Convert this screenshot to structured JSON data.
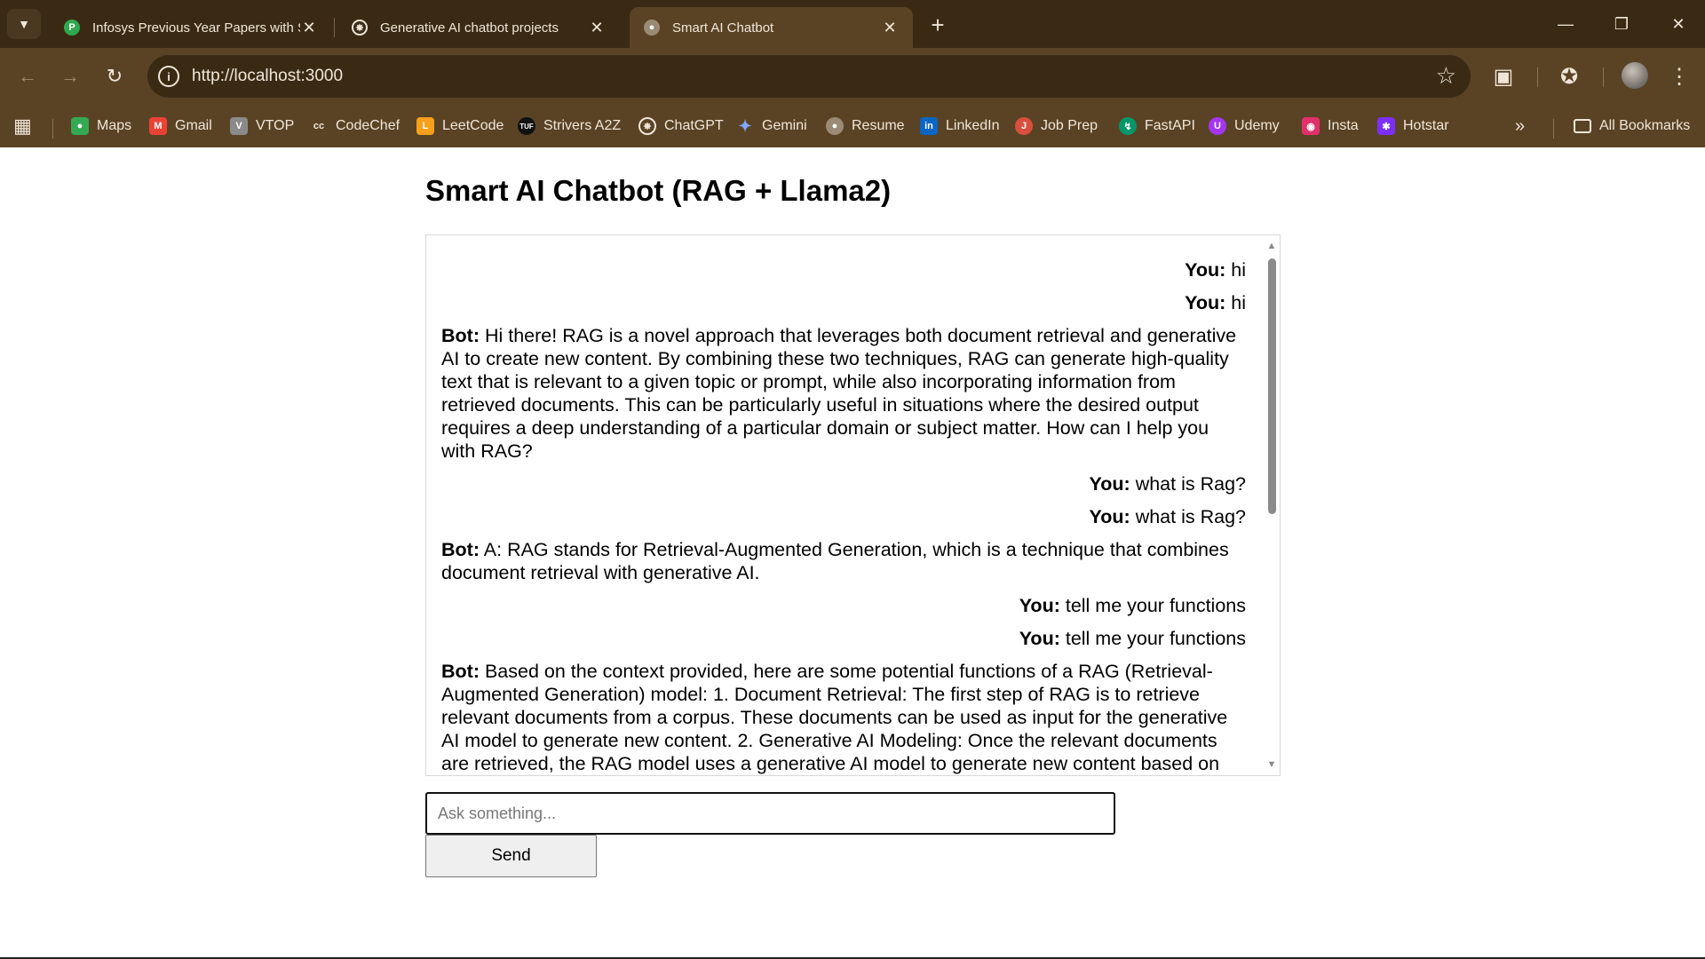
{
  "browser": {
    "tabs": [
      {
        "title": "Infosys Previous Year Papers with S",
        "favicon": "prepinsta-favicon",
        "active": false
      },
      {
        "title": "Generative AI chatbot projects",
        "favicon": "chatgpt-favicon",
        "active": false
      },
      {
        "title": "Smart AI Chatbot",
        "favicon": "globe-favicon",
        "active": true
      }
    ],
    "url": "http://localhost:3000",
    "bookmarks": [
      {
        "label": "Maps",
        "icon": "maps-icon",
        "color": "#34a853"
      },
      {
        "label": "Gmail",
        "icon": "gmail-icon",
        "color": "#ea4335"
      },
      {
        "label": "VTOP",
        "icon": "vtop-icon",
        "color": "#8a8a8a"
      },
      {
        "label": "CodeChef",
        "icon": "codechef-icon",
        "color": "#5b4638"
      },
      {
        "label": "LeetCode",
        "icon": "leetcode-icon",
        "color": "#f89f1b"
      },
      {
        "label": "Strivers A2Z",
        "icon": "tuf-icon",
        "color": "#111111"
      },
      {
        "label": "ChatGPT",
        "icon": "chatgpt-icon",
        "color": "#5a4325"
      },
      {
        "label": "Gemini",
        "icon": "gemini-icon",
        "color": "#4285f4"
      },
      {
        "label": "Resume",
        "icon": "globe-icon",
        "color": "#5a4325"
      },
      {
        "label": "LinkedIn",
        "icon": "linkedin-icon",
        "color": "#0a66c2"
      },
      {
        "label": "Job Prep",
        "icon": "jobprep-icon",
        "color": "#d94f3d"
      },
      {
        "label": "FastAPI",
        "icon": "fastapi-icon",
        "color": "#059669"
      },
      {
        "label": "Udemy",
        "icon": "udemy-icon",
        "color": "#a435f0"
      },
      {
        "label": "Insta",
        "icon": "instagram-icon",
        "color": "#e1306c"
      },
      {
        "label": "Hotstar",
        "icon": "hotstar-icon",
        "color": "#7b2ff7"
      }
    ],
    "all_bookmarks_label": "All Bookmarks"
  },
  "page": {
    "title": "Smart AI Chatbot (RAG + Llama2)",
    "messages": [
      {
        "role": "user",
        "speaker": "You:",
        "text": "hi"
      },
      {
        "role": "user",
        "speaker": "You:",
        "text": "hi"
      },
      {
        "role": "bot",
        "speaker": "Bot:",
        "text": "Hi there! RAG is a novel approach that leverages both document retrieval and generative AI to create new content. By combining these two techniques, RAG can generate high-quality text that is relevant to a given topic or prompt, while also incorporating information from retrieved documents. This can be particularly useful in situations where the desired output requires a deep understanding of a particular domain or subject matter. How can I help you with RAG?"
      },
      {
        "role": "user",
        "speaker": "You:",
        "text": "what is Rag?"
      },
      {
        "role": "user",
        "speaker": "You:",
        "text": "what is Rag?"
      },
      {
        "role": "bot",
        "speaker": "Bot:",
        "text": "A: RAG stands for Retrieval-Augmented Generation, which is a technique that combines document retrieval with generative AI."
      },
      {
        "role": "user",
        "speaker": "You:",
        "text": "tell me your functions"
      },
      {
        "role": "user",
        "speaker": "You:",
        "text": "tell me your functions"
      },
      {
        "role": "bot",
        "speaker": "Bot:",
        "text": "Based on the context provided, here are some potential functions of a RAG (Retrieval-Augmented Generation) model: 1. Document Retrieval: The first step of RAG is to retrieve relevant documents from a corpus. These documents can be used as input for the generative AI model to generate new content. 2. Generative AI Modeling: Once the relevant documents are retrieved, the RAG model uses a generative AI model to generate new content based on"
      }
    ],
    "input_placeholder": "Ask something...",
    "input_value": "",
    "send_label": "Send"
  }
}
